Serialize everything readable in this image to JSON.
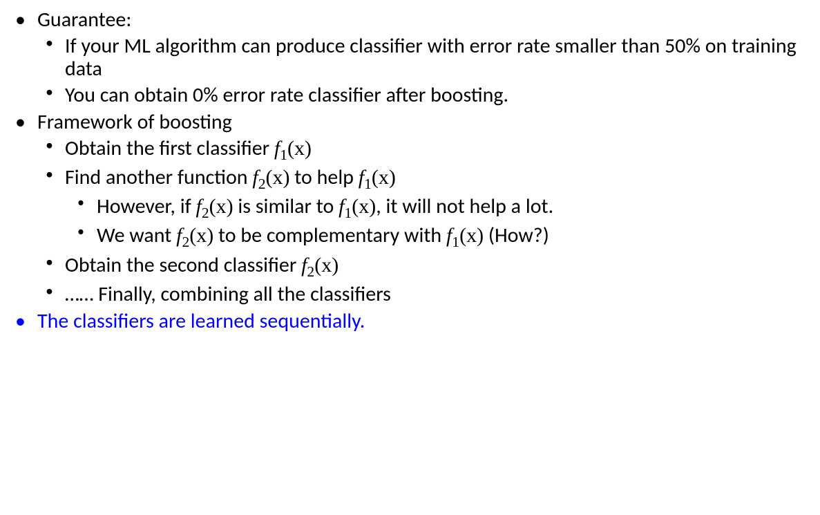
{
  "slide": {
    "guarantee": {
      "label": "Guarantee:",
      "points": {
        "p0": "If your ML algorithm can produce classifier with error rate smaller than 50% on training data",
        "p1": "You can obtain 0% error rate classifier after boosting."
      }
    },
    "framework": {
      "label": "Framework of boosting",
      "step1_pre": "Obtain the first classifier ",
      "f1": "f",
      "f1_sub": "1",
      "f1_arg": "(x)",
      "step2_pre": "Find another function ",
      "step2_mid": " to help ",
      "f2": "f",
      "f2_sub": "2",
      "f2_arg": "(x)",
      "sub_a_pre": "However, if ",
      "sub_a_mid": " is similar to ",
      "sub_a_post": ", it will not help a lot.",
      "sub_b_pre": "We want ",
      "sub_b_mid": " to be complementary with ",
      "sub_b_post": " (How?)",
      "step3_pre": "Obtain the second classifier ",
      "step4": "…… Finally, combining all the classifiers"
    },
    "sequential": "The classifiers are learned sequentially."
  }
}
